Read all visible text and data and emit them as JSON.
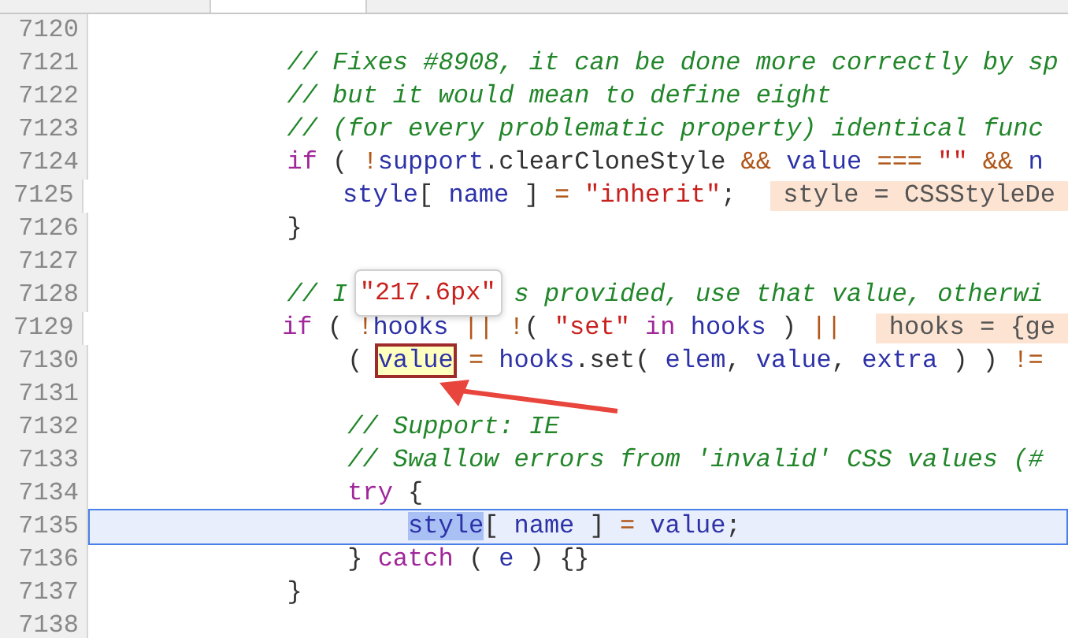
{
  "editor": {
    "lines": [
      {
        "number": "7120",
        "current": false
      },
      {
        "number": "7121",
        "current": false,
        "parts": [
          {
            "kind": "comment",
            "text": "            // Fixes #8908, it can be done more correctly by sp"
          }
        ]
      },
      {
        "number": "7122",
        "current": false,
        "parts": [
          {
            "kind": "comment",
            "text": "            // but it would mean to define eight"
          }
        ]
      },
      {
        "number": "7123",
        "current": false,
        "parts": [
          {
            "kind": "comment",
            "text": "            // (for every problematic property) identical func"
          }
        ]
      },
      {
        "number": "7124",
        "current": false,
        "parts": [
          {
            "kind": "keyword",
            "text": "            if"
          },
          {
            "kind": "plain",
            "text": " ( "
          },
          {
            "kind": "op",
            "text": "!"
          },
          {
            "kind": "ident",
            "text": "support"
          },
          {
            "kind": "plain",
            "text": ".clearCloneStyle"
          },
          {
            "kind": "op",
            "text": " && "
          },
          {
            "kind": "ident",
            "text": "value"
          },
          {
            "kind": "op",
            "text": " === "
          },
          {
            "kind": "string",
            "text": "\"\""
          },
          {
            "kind": "op",
            "text": " && "
          },
          {
            "kind": "ident",
            "text": "n"
          }
        ]
      },
      {
        "number": "7125",
        "current": false,
        "parts": [
          {
            "kind": "ident",
            "text": "                style"
          },
          {
            "kind": "plain",
            "text": "[ "
          },
          {
            "kind": "ident",
            "text": "name"
          },
          {
            "kind": "plain",
            "text": " ] "
          },
          {
            "kind": "op",
            "text": "= "
          },
          {
            "kind": "string",
            "text": "\"inherit\""
          },
          {
            "kind": "plain",
            "text": ";"
          },
          {
            "kind": "hint",
            "text": "style = CSSStyleDe"
          }
        ]
      },
      {
        "number": "7126",
        "current": false,
        "parts": [
          {
            "kind": "plain",
            "text": "            }"
          }
        ]
      },
      {
        "number": "7127",
        "current": false
      },
      {
        "number": "7128",
        "current": false,
        "parts": [
          {
            "kind": "comment",
            "text": "            // I"
          },
          {
            "kind": "tooltip",
            "text": "\"217.6px\""
          },
          {
            "kind": "comment",
            "text": "s provided, use that value, otherwi"
          }
        ]
      },
      {
        "number": "7129",
        "current": false,
        "parts": [
          {
            "kind": "keyword",
            "text": "            if"
          },
          {
            "kind": "plain",
            "text": " ( "
          },
          {
            "kind": "op",
            "text": "!"
          },
          {
            "kind": "ident",
            "text": "hooks"
          },
          {
            "kind": "op",
            "text": " || !"
          },
          {
            "kind": "plain",
            "text": "( "
          },
          {
            "kind": "string",
            "text": "\"set\""
          },
          {
            "kind": "keyword",
            "text": " in "
          },
          {
            "kind": "ident",
            "text": "hooks"
          },
          {
            "kind": "plain",
            "text": " ) "
          },
          {
            "kind": "op",
            "text": "||"
          },
          {
            "kind": "hint",
            "text": "hooks = {ge"
          }
        ]
      },
      {
        "number": "7130",
        "current": false,
        "parts": [
          {
            "kind": "plain",
            "text": "                ( "
          },
          {
            "kind": "boxed",
            "text": "value"
          },
          {
            "kind": "op",
            "text": " = "
          },
          {
            "kind": "ident",
            "text": "hooks"
          },
          {
            "kind": "plain",
            "text": ".set( "
          },
          {
            "kind": "ident",
            "text": "elem"
          },
          {
            "kind": "plain",
            "text": ", "
          },
          {
            "kind": "ident",
            "text": "value"
          },
          {
            "kind": "plain",
            "text": ", "
          },
          {
            "kind": "ident",
            "text": "extra"
          },
          {
            "kind": "plain",
            "text": " ) ) "
          },
          {
            "kind": "op",
            "text": "!="
          }
        ]
      },
      {
        "number": "7131",
        "current": false
      },
      {
        "number": "7132",
        "current": false,
        "parts": [
          {
            "kind": "comment",
            "text": "                // Support: IE"
          }
        ]
      },
      {
        "number": "7133",
        "current": false,
        "parts": [
          {
            "kind": "comment",
            "text": "                // Swallow errors from 'invalid' CSS values (#"
          }
        ]
      },
      {
        "number": "7134",
        "current": false,
        "parts": [
          {
            "kind": "keyword",
            "text": "                try"
          },
          {
            "kind": "plain",
            "text": " {"
          }
        ]
      },
      {
        "number": "7135",
        "current": true,
        "parts": [
          {
            "kind": "selected",
            "text": "                    style"
          },
          {
            "kind": "plain",
            "text": "[ "
          },
          {
            "kind": "ident",
            "text": "name"
          },
          {
            "kind": "plain",
            "text": " ] "
          },
          {
            "kind": "op",
            "text": "= "
          },
          {
            "kind": "ident",
            "text": "value"
          },
          {
            "kind": "plain",
            "text": ";"
          }
        ]
      },
      {
        "number": "7136",
        "current": false,
        "parts": [
          {
            "kind": "plain",
            "text": "                } "
          },
          {
            "kind": "keyword",
            "text": "catch"
          },
          {
            "kind": "plain",
            "text": " ( "
          },
          {
            "kind": "ident",
            "text": "e"
          },
          {
            "kind": "plain",
            "text": " ) {}"
          }
        ]
      },
      {
        "number": "7137",
        "current": false,
        "parts": [
          {
            "kind": "plain",
            "text": "            }"
          }
        ]
      },
      {
        "number": "7138",
        "current": false
      }
    ]
  }
}
